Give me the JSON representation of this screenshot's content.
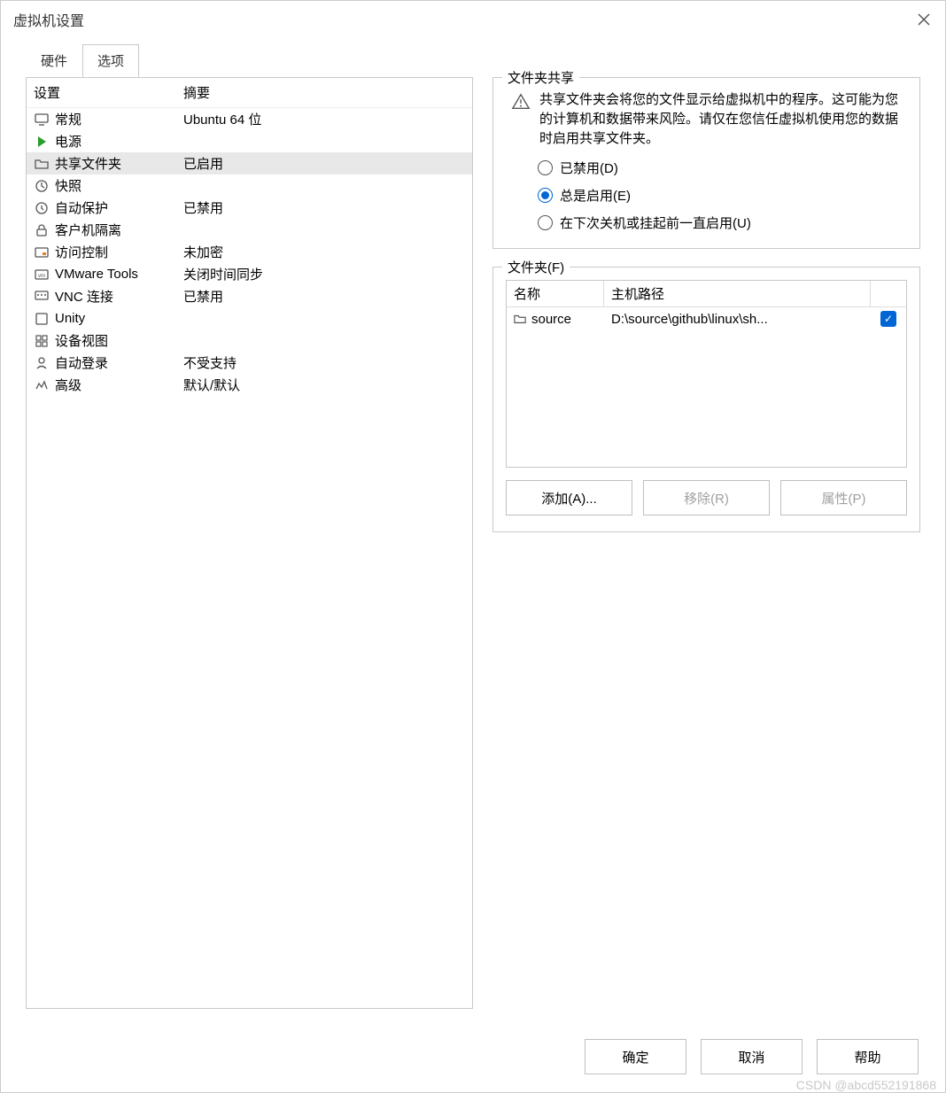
{
  "window": {
    "title": "虚拟机设置"
  },
  "tabs": {
    "hardware": "硬件",
    "options": "选项"
  },
  "settings_header": {
    "col_setting": "设置",
    "col_summary": "摘要"
  },
  "settings": [
    {
      "icon": "monitor-icon",
      "label": "常规",
      "summary": "Ubuntu 64 位"
    },
    {
      "icon": "play-icon",
      "label": "电源",
      "summary": ""
    },
    {
      "icon": "folder-share-icon",
      "label": "共享文件夹",
      "summary": "已启用",
      "selected": true
    },
    {
      "icon": "snapshot-icon",
      "label": "快照",
      "summary": ""
    },
    {
      "icon": "clock-icon",
      "label": "自动保护",
      "summary": "已禁用"
    },
    {
      "icon": "lock-icon",
      "label": "客户机隔离",
      "summary": ""
    },
    {
      "icon": "access-icon",
      "label": "访问控制",
      "summary": "未加密"
    },
    {
      "icon": "vmware-icon",
      "label": "VMware Tools",
      "summary": "关闭时间同步"
    },
    {
      "icon": "vnc-icon",
      "label": "VNC 连接",
      "summary": "已禁用"
    },
    {
      "icon": "unity-icon",
      "label": "Unity",
      "summary": ""
    },
    {
      "icon": "device-view-icon",
      "label": "设备视图",
      "summary": ""
    },
    {
      "icon": "autologin-icon",
      "label": "自动登录",
      "summary": "不受支持"
    },
    {
      "icon": "advanced-icon",
      "label": "高级",
      "summary": "默认/默认"
    }
  ],
  "sharing": {
    "group_label": "文件夹共享",
    "warning": "共享文件夹会将您的文件显示给虚拟机中的程序。这可能为您的计算机和数据带来风险。请仅在您信任虚拟机使用您的数据时启用共享文件夹。",
    "radio_disabled": "已禁用(D)",
    "radio_always": "总是启用(E)",
    "radio_until": "在下次关机或挂起前一直启用(U)",
    "selected": "always"
  },
  "folders": {
    "group_label": "文件夹(F)",
    "col_name": "名称",
    "col_path": "主机路径",
    "rows": [
      {
        "name": "source",
        "path": "D:\\source\\github\\linux\\sh...",
        "enabled": true
      }
    ],
    "add_button": "添加(A)...",
    "remove_button": "移除(R)",
    "props_button": "属性(P)"
  },
  "dialog": {
    "ok": "确定",
    "cancel": "取消",
    "help": "帮助"
  },
  "watermark": "CSDN @abcd552191868"
}
